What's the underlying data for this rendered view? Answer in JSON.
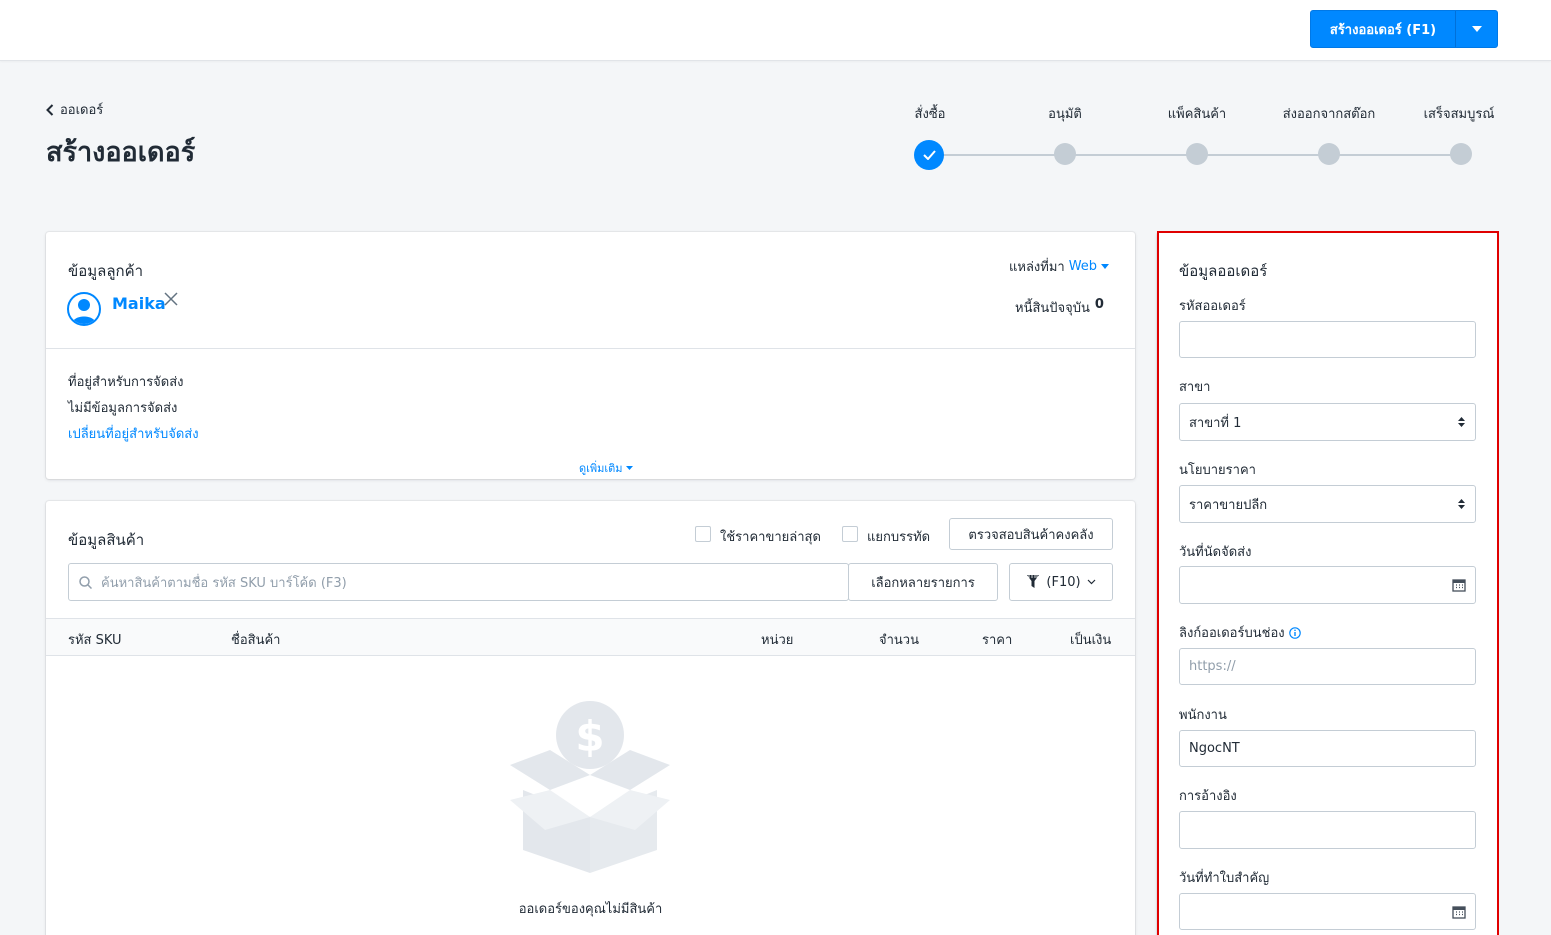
{
  "header": {
    "create_button_label": "สร้างออเดอร์ (F1)"
  },
  "breadcrumb": {
    "back_label": "ออเดอร์"
  },
  "page_title": "สร้างออเดอร์",
  "steps": [
    {
      "label": "สั่งซื้อ",
      "state": "done"
    },
    {
      "label": "อนุมัติ",
      "state": "pending"
    },
    {
      "label": "แพ็คสินค้า",
      "state": "pending"
    },
    {
      "label": "ส่งออกจากสต๊อก",
      "state": "pending"
    },
    {
      "label": "เสร็จสมบูรณ์",
      "state": "pending"
    }
  ],
  "customer": {
    "title": "ข้อมูลลูกค้า",
    "source_label": "แหล่งที่มา",
    "source_value": "Web",
    "name": "Maika",
    "debt_label": "หนี้สินปัจจุบัน",
    "debt_value": "0",
    "address_title": "ที่อยู่สำหรับการจัดส่ง",
    "no_address": "ไม่มีข้อมูลการจัดส่ง",
    "change_address": "เปลี่ยนที่อยู่สำหรับจัดส่ง",
    "see_more": "ดูเพิ่มเติม"
  },
  "products": {
    "title": "ข้อมูลสินค้า",
    "use_latest_price": "ใช้ราคาขายล่าสุด",
    "split_lines": "แยกบรรทัด",
    "check_stock_button": "ตรวจสอบสินค้าคงคลัง",
    "search_placeholder": "ค้นหาสินค้าตามชื่อ รหัส SKU บาร์โค้ด (F3)",
    "select_multiple_button": "เลือกหลายรายการ",
    "filter_button": "(F10)",
    "columns": [
      "รหัส SKU",
      "ชื่อสินค้า",
      "หน่วย",
      "จำนวน",
      "ราคา",
      "เป็นเงิน"
    ],
    "empty_message": "ออเดอร์ของคุณไม่มีสินค้า"
  },
  "order_info": {
    "title": "ข้อมูลออเดอร์",
    "order_code_label": "รหัสออเดอร์",
    "order_code_value": "",
    "branch_label": "สาขา",
    "branch_value": "สาขาที่ 1",
    "price_policy_label": "นโยบายราคา",
    "price_policy_value": "ราคาขายปลีก",
    "delivery_date_label": "วันที่นัดจัดส่ง",
    "delivery_date_value": "",
    "channel_link_label": "ลิงก์ออเดอร์บนช่อง",
    "channel_link_placeholder": "https://",
    "staff_label": "พนักงาน",
    "staff_value": "NgocNT",
    "reference_label": "การอ้างอิง",
    "reference_value": "",
    "issue_date_label": "วันที่ทำใบสำคัญ",
    "issue_date_value": ""
  },
  "colors": {
    "accent": "#0088ff",
    "highlight_border": "#e00000",
    "step_inactive": "#c4cdd5"
  }
}
